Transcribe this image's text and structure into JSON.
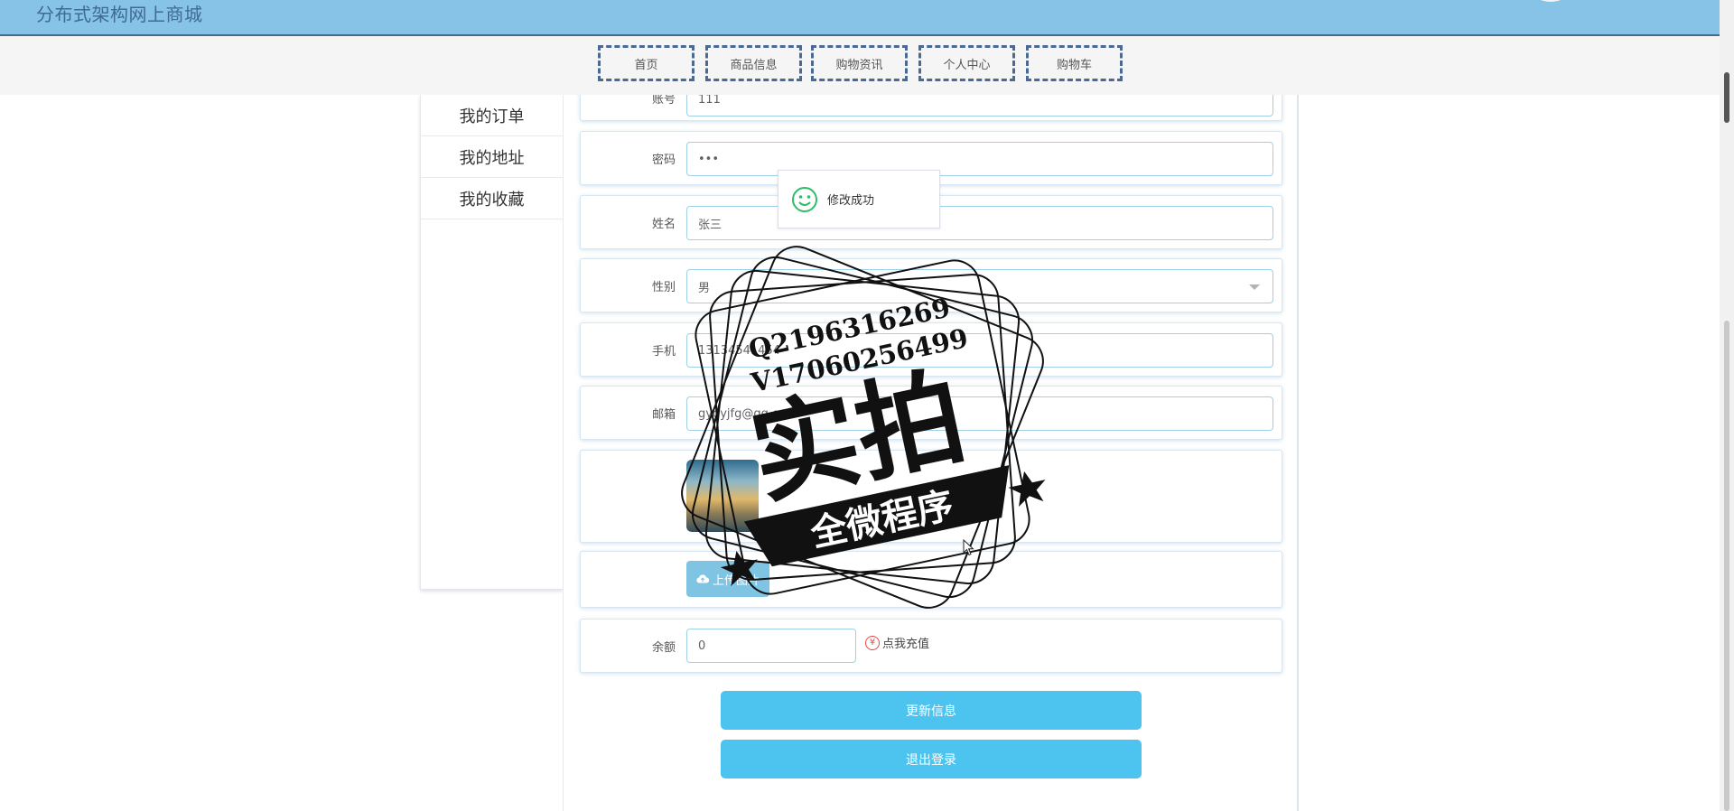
{
  "header": {
    "site_title": "分布式架构网上商城"
  },
  "nav": [
    {
      "label": "首页"
    },
    {
      "label": "商品信息"
    },
    {
      "label": "购物资讯"
    },
    {
      "label": "个人中心"
    },
    {
      "label": "购物车"
    }
  ],
  "sidebar": {
    "items": [
      {
        "label": "我的订单"
      },
      {
        "label": "我的地址"
      },
      {
        "label": "我的收藏"
      }
    ]
  },
  "form": {
    "account": {
      "label": "账号",
      "value": "111"
    },
    "password": {
      "label": "密码",
      "value": "•••"
    },
    "name": {
      "label": "姓名",
      "value": "张三"
    },
    "gender": {
      "label": "性别",
      "value": "男"
    },
    "phone": {
      "label": "手机",
      "value": "13134541454"
    },
    "email": {
      "label": "邮箱",
      "value": "gygyjfg@qq.com"
    },
    "upload_label": "上传图片",
    "balance": {
      "label": "余额",
      "value": "0"
    },
    "recharge_label": "点我充值",
    "recharge_icon": "yen-icon"
  },
  "buttons": {
    "update": "更新信息",
    "logout": "退出登录"
  },
  "toast": {
    "message": "修改成功",
    "icon": "smile-icon",
    "color": "#2ebd6b"
  },
  "watermark": {
    "line1": "Q2196316269",
    "line2": "V17060256499",
    "main": "实拍",
    "banner": "全微程序"
  },
  "colors": {
    "header_bg": "#87c3e6",
    "button_bg": "#4dc4ef",
    "upload_bg": "#7fc4e3"
  }
}
